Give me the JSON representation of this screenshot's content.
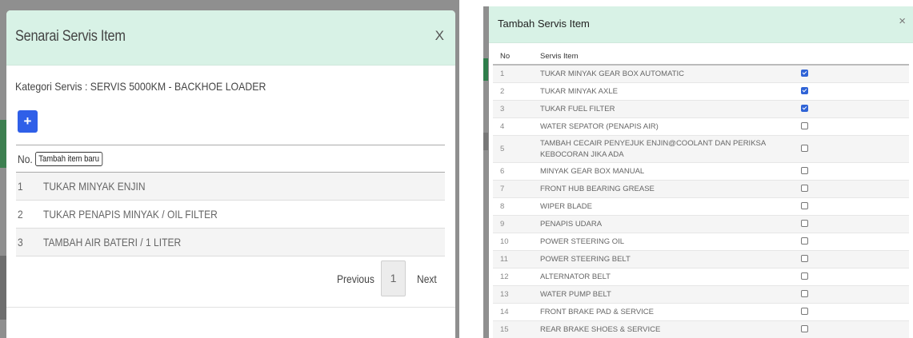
{
  "left_modal": {
    "title": "Senarai Servis Item",
    "close_label": "X",
    "category_text": "Kategori Servis : SERVIS 5000KM - BACKHOE LOADER",
    "add_button_label": "+",
    "tooltip": "Tambah item baru",
    "column_no": "No.",
    "rows": [
      {
        "no": "1",
        "item": "TUKAR MINYAK ENJIN"
      },
      {
        "no": "2",
        "item": "TUKAR PENAPIS MINYAK / OIL FILTER"
      },
      {
        "no": "3",
        "item": "TAMBAH AIR BATERI / 1 LITER"
      }
    ],
    "pagination": {
      "previous": "Previous",
      "page": "1",
      "next": "Next"
    }
  },
  "right_modal": {
    "title": "Tambah Servis Item",
    "close_label": "×",
    "columns": {
      "no": "No",
      "item": "Servis Item"
    },
    "rows": [
      {
        "no": "1",
        "item": "TUKAR MINYAK GEAR BOX AUTOMATIC",
        "checked": true
      },
      {
        "no": "2",
        "item": "TUKAR MINYAK AXLE",
        "checked": true
      },
      {
        "no": "3",
        "item": "TUKAR FUEL FILTER",
        "checked": true
      },
      {
        "no": "4",
        "item": "WATER SEPATOR (PENAPIS AIR)",
        "checked": false
      },
      {
        "no": "5",
        "item": "TAMBAH CECAIR PENYEJUK ENJIN@COOLANT DAN PERIKSA KEBOCORAN JIKA ADA",
        "checked": false
      },
      {
        "no": "6",
        "item": "MINYAK GEAR BOX MANUAL",
        "checked": false
      },
      {
        "no": "7",
        "item": "FRONT HUB BEARING GREASE",
        "checked": false
      },
      {
        "no": "8",
        "item": "WIPER BLADE",
        "checked": false
      },
      {
        "no": "9",
        "item": "PENAPIS UDARA",
        "checked": false
      },
      {
        "no": "10",
        "item": "POWER STEERING OIL",
        "checked": false
      },
      {
        "no": "11",
        "item": "POWER STEERING BELT",
        "checked": false
      },
      {
        "no": "12",
        "item": "ALTERNATOR BELT",
        "checked": false
      },
      {
        "no": "13",
        "item": "WATER PUMP BELT",
        "checked": false
      },
      {
        "no": "14",
        "item": "FRONT BRAKE PAD & SERVICE",
        "checked": false
      },
      {
        "no": "15",
        "item": "REAR BRAKE SHOES & SERVICE",
        "checked": false
      }
    ]
  },
  "colors": {
    "header_bg": "#d8f2e6",
    "primary_button": "#2f5fe8",
    "checkbox_checked": "#2f63d6",
    "overlay": "#8f8f8f"
  }
}
